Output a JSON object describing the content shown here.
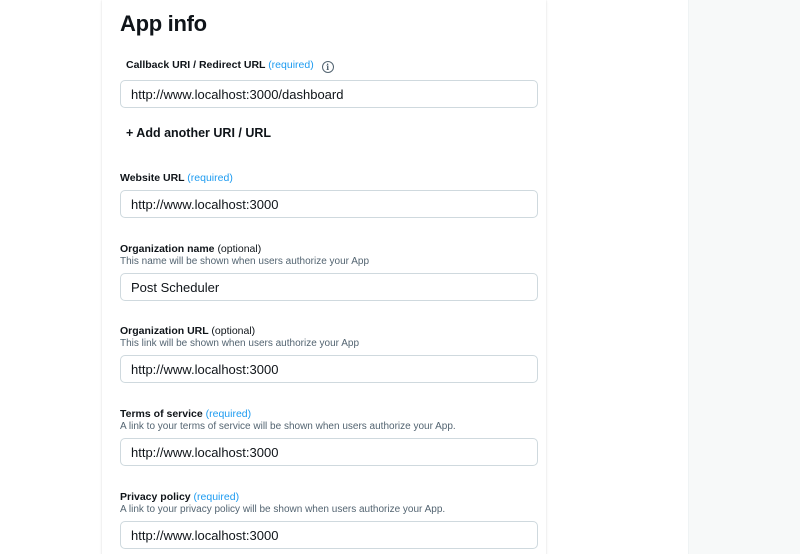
{
  "page": {
    "title": "App info"
  },
  "callback": {
    "label": "Callback URI / Redirect URL",
    "required": "(required)",
    "value": "http://www.localhost:3000/dashboard",
    "add_link": "+ Add another URI / URL"
  },
  "website": {
    "label": "Website URL",
    "required": "(required)",
    "value": "http://www.localhost:3000"
  },
  "org_name": {
    "label": "Organization name",
    "optional": "(optional)",
    "hint": "This name will be shown when users authorize your App",
    "value": "Post Scheduler"
  },
  "org_url": {
    "label": "Organization URL",
    "optional": "(optional)",
    "hint": "This link will be shown when users authorize your App",
    "value": "http://www.localhost:3000"
  },
  "terms": {
    "label": "Terms of service",
    "required": "(required)",
    "hint": "A link to your terms of service will be shown when users authorize your App.",
    "value": "http://www.localhost:3000"
  },
  "privacy": {
    "label": "Privacy policy",
    "required": "(required)",
    "hint": "A link to your privacy policy will be shown when users authorize your App.",
    "value": "http://www.localhost:3000"
  },
  "icons": {
    "callback_info": "info-icon"
  },
  "colors": {
    "required": "#1d9bf0",
    "border": "#cfd9de",
    "hint": "#536471"
  }
}
